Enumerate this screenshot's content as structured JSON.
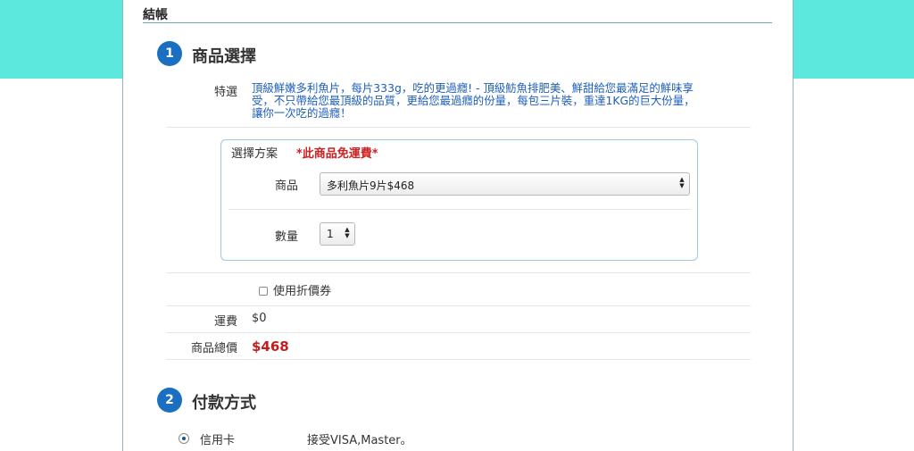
{
  "page": {
    "title": "結帳"
  },
  "step1": {
    "number": "1",
    "title": "商品選擇",
    "feature_label": "特選",
    "feature_lines": [
      "頂級鮮嫩多利魚片，每片333g，吃的更過癮! - 頂級魴魚排肥美、鮮甜給您最滿足的鮮味享",
      "受，不只帶給您最頂級的品質，更給您最過癮的份量，每包三片裝，重達1KG的巨大份量，",
      "讓你一次吃的過癮！"
    ],
    "plan": {
      "title": "選擇方案",
      "note": "*此商品免運費*",
      "product_label": "商品",
      "product_value": "多利魚片9片$468",
      "quantity_label": "數量",
      "quantity_value": "1"
    },
    "coupon_label": "使用折價券",
    "shipping_label": "運費",
    "shipping_value": "$0",
    "total_label": "商品總價",
    "total_value": "$468"
  },
  "step2": {
    "number": "2",
    "title": "付款方式",
    "option_label": "信用卡",
    "option_desc": "接受VISA,Master。"
  },
  "colors": {
    "accent": "#1a6fc0",
    "background_band": "#5ce8dc",
    "feature_text": "#1f5fb8",
    "price_red": "#c41d1d"
  }
}
